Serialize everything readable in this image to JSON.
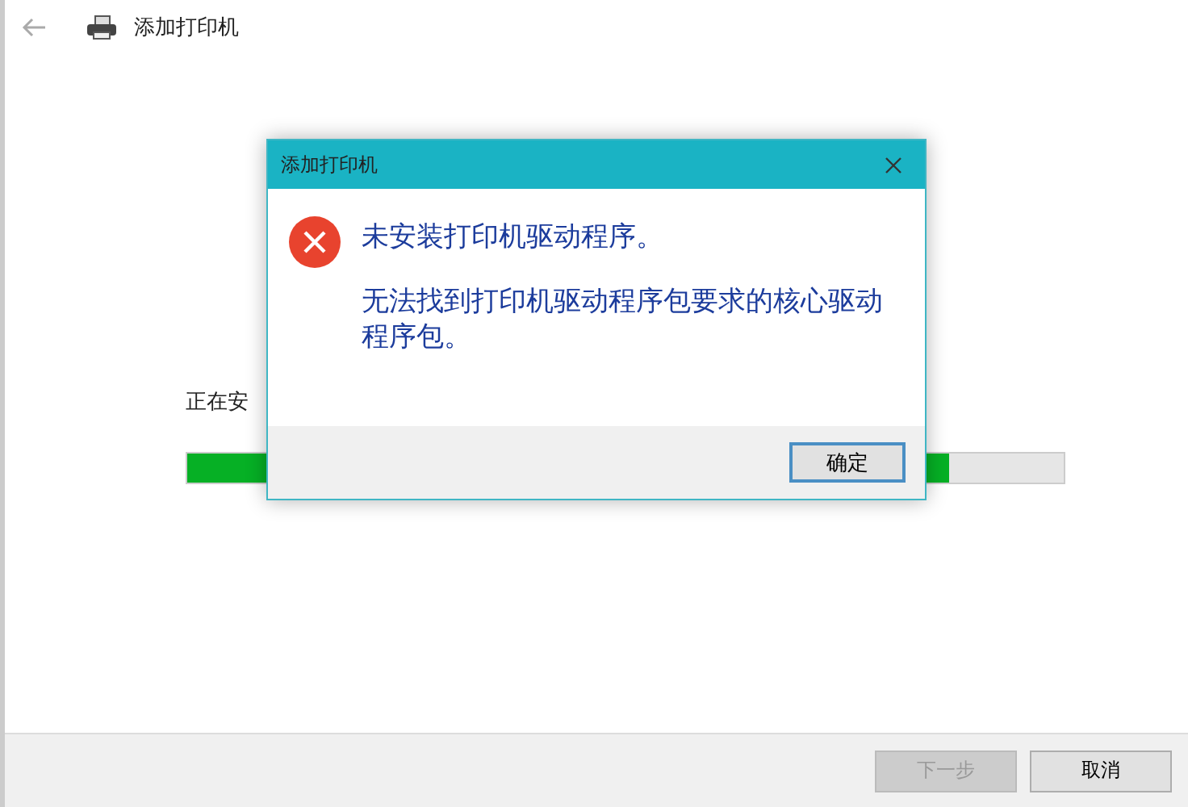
{
  "window": {
    "title": "添加打印机"
  },
  "status_text": "正在安",
  "progress": {
    "level": 0.87
  },
  "dialog": {
    "title": "添加打印机",
    "heading": "未安装打印机驱动程序。",
    "message": "无法找到打印机驱动程序包要求的核心驱动程序包。",
    "button": "确定"
  },
  "buttons": [
    {
      "label": "下一步",
      "disabled": true
    },
    {
      "label": "取消",
      "disabled": false
    }
  ]
}
